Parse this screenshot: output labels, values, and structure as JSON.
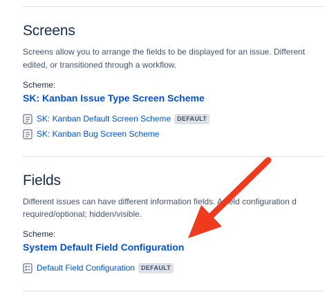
{
  "screens": {
    "title": "Screens",
    "description_line1": "Screens allow you to arrange the fields to be displayed for an issue. Different",
    "description_line2": "edited, or transitioned through a workflow.",
    "scheme_label": "Scheme:",
    "scheme_name": "SK: Kanban Issue Type Screen Scheme",
    "items": [
      {
        "label": "SK: Kanban Default Screen Scheme",
        "badge": "DEFAULT",
        "icon": "screen-scheme-icon"
      },
      {
        "label": "SK: Kanban Bug Screen Scheme",
        "badge": "",
        "icon": "screen-scheme-icon"
      }
    ]
  },
  "fields": {
    "title": "Fields",
    "description_line1": "Different issues can have different information fields. A field configuration d",
    "description_line2": "required/optional; hidden/visible.",
    "scheme_label": "Scheme:",
    "scheme_name": "System Default Field Configuration",
    "items": [
      {
        "label": "Default Field Configuration",
        "badge": "DEFAULT",
        "icon": "field-config-icon"
      }
    ]
  },
  "colors": {
    "link": "#0052cc",
    "text": "#172b4d",
    "muted": "#42526e",
    "badge_bg": "#dfe1e6",
    "annotation_arrow": "#f03a1e"
  }
}
